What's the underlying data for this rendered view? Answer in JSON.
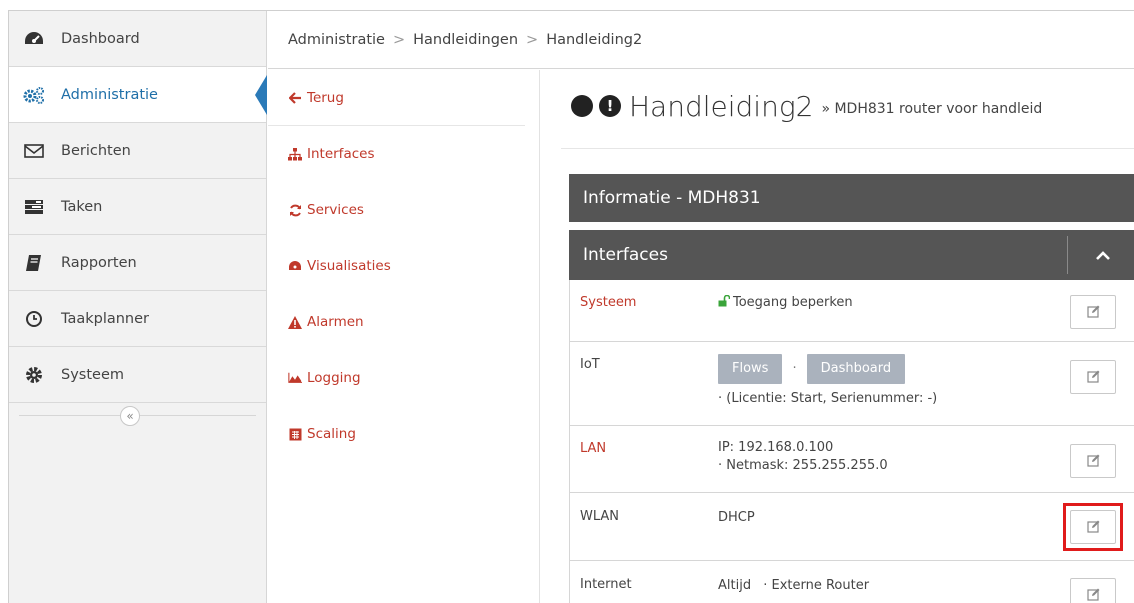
{
  "sidebar": {
    "items": [
      {
        "label": "Dashboard",
        "icon": "dashboard-gauge-icon"
      },
      {
        "label": "Administratie",
        "icon": "cogs-icon",
        "active": true
      },
      {
        "label": "Berichten",
        "icon": "envelope-icon"
      },
      {
        "label": "Taken",
        "icon": "tasks-icon"
      },
      {
        "label": "Rapporten",
        "icon": "book-icon"
      },
      {
        "label": "Taakplanner",
        "icon": "clock-icon"
      },
      {
        "label": "Systeem",
        "icon": "gear-icon"
      }
    ],
    "collapse_glyph": "«"
  },
  "breadcrumb": {
    "items": [
      "Administratie",
      "Handleidingen",
      "Handleiding2"
    ],
    "separator": ">"
  },
  "subnav": {
    "items": [
      {
        "label": "Terug",
        "icon": "arrow-left-icon"
      },
      {
        "label": "Interfaces",
        "icon": "sitemap-icon"
      },
      {
        "label": "Services",
        "icon": "refresh-icon"
      },
      {
        "label": "Visualisaties",
        "icon": "dashboard-icon"
      },
      {
        "label": "Alarmen",
        "icon": "warning-icon"
      },
      {
        "label": "Logging",
        "icon": "area-chart-icon"
      },
      {
        "label": "Scaling",
        "icon": "calculator-icon"
      }
    ]
  },
  "main": {
    "title": "Handleiding2",
    "subtitle": "» MDH831 router voor handleid",
    "info_header": "Informatie - MDH831",
    "interfaces_header": "Interfaces",
    "rows": [
      {
        "label": "Systeem",
        "value": "Toegang beperken"
      },
      {
        "label": "IoT",
        "flows": "Flows",
        "dot": "·",
        "dashboard": "Dashboard",
        "value2": "· (Licentie: Start, Serienummer: -)"
      },
      {
        "label": "LAN",
        "value": "IP: 192.168.0.100",
        "value2": "· Netmask: 255.255.255.0"
      },
      {
        "label": "WLAN",
        "value": "DHCP"
      },
      {
        "label": "Internet",
        "value": "Altijd",
        "value2": "· Externe Router"
      }
    ]
  },
  "colors": {
    "accent": "#2a7ab8",
    "link_red": "#c0392b",
    "header_bg": "#555555",
    "highlight": "#e01b1b",
    "unlock_green": "#3aa43a"
  }
}
